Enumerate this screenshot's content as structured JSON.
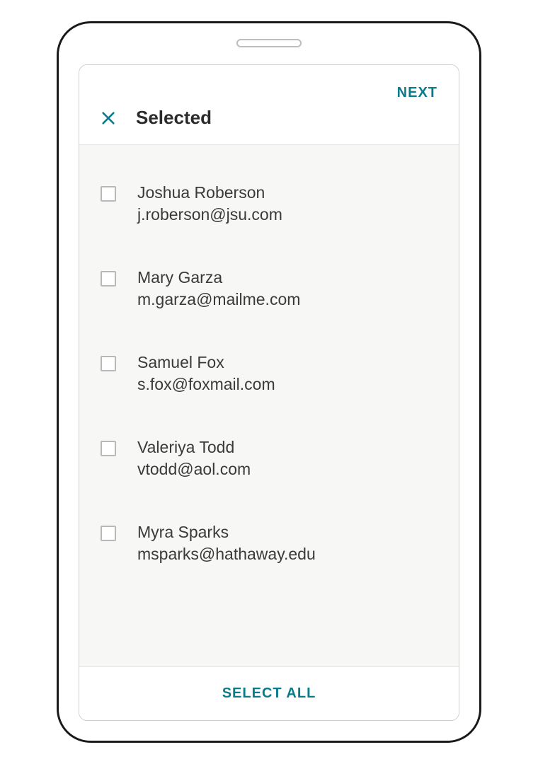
{
  "header": {
    "next_label": "NEXT",
    "title": "Selected"
  },
  "contacts": [
    {
      "name": "Joshua Roberson",
      "email": "j.roberson@jsu.com"
    },
    {
      "name": "Mary Garza",
      "email": "m.garza@mailme.com"
    },
    {
      "name": "Samuel Fox",
      "email": "s.fox@foxmail.com"
    },
    {
      "name": "Valeriya Todd",
      "email": "vtodd@aol.com"
    },
    {
      "name": "Myra Sparks",
      "email": "msparks@hathaway.edu"
    }
  ],
  "footer": {
    "select_all_label": "SELECT ALL"
  }
}
